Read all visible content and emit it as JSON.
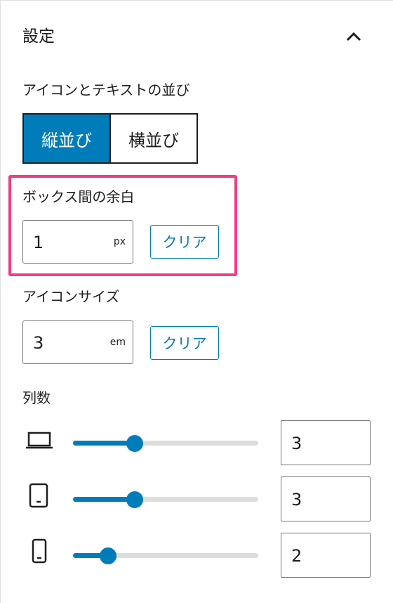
{
  "panel": {
    "title": "設定"
  },
  "layout_section": {
    "label": "アイコンとテキストの並び",
    "options": [
      {
        "label": "縦並び",
        "selected": true
      },
      {
        "label": "横並び",
        "selected": false
      }
    ]
  },
  "box_spacing": {
    "label": "ボックス間の余白",
    "value": "1",
    "unit": "px",
    "clear_label": "クリア"
  },
  "icon_size": {
    "label": "アイコンサイズ",
    "value": "3",
    "unit": "em",
    "clear_label": "クリア"
  },
  "columns": {
    "label": "列数",
    "rows": [
      {
        "device": "laptop-icon",
        "value": "3",
        "min": 1,
        "max": 6,
        "level": 3
      },
      {
        "device": "tablet-icon",
        "value": "3",
        "min": 1,
        "max": 6,
        "level": 3
      },
      {
        "device": "mobile-icon",
        "value": "2",
        "min": 1,
        "max": 6,
        "level": 2
      }
    ]
  },
  "colors": {
    "accent": "#007cba",
    "highlight": "#f43c82",
    "text": "#1e1e1e"
  }
}
